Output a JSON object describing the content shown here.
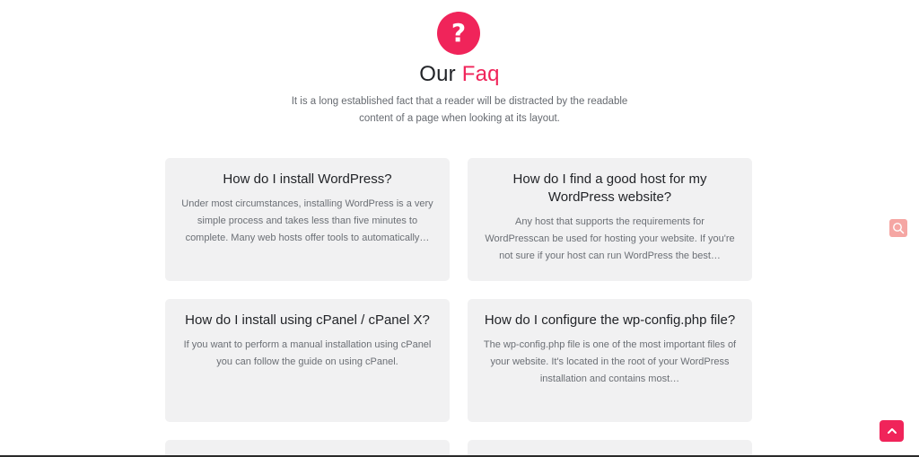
{
  "header": {
    "icon_glyph": "?",
    "title_main": "Our",
    "title_accent": "Faq",
    "description": "It is a long established fact that a reader will be distracted by the readable content of a page when looking at its layout."
  },
  "faqs": [
    {
      "question": "How do I install WordPress?",
      "answer": "Under most circumstances, installing WordPress is a very simple process and takes less than five minutes to complete. Many web hosts offer tools to automatically…"
    },
    {
      "question": "How do I find a good host for my WordPress website?",
      "answer": "Any host that supports the requirements for WordPresscan be used for hosting your website. If you're not sure if your host can run WordPress the best…"
    },
    {
      "question": "How do I install using cPanel / cPanel X?",
      "answer": "If you want to perform a manual installation using cPanel you can follow the guide on using cPanel."
    },
    {
      "question": "How do I configure the wp-config.php file?",
      "answer": "The wp-config.php file is one of the most important files of your website. It's located in the root of your WordPress installation and contains most…"
    }
  ],
  "controls": {
    "search_icon": "search-icon",
    "back_to_top_icon": "chevron-up-icon"
  },
  "colors": {
    "accent": "#f0245a",
    "card_bg": "#f1f1f2",
    "search_bg": "#f5a6a3"
  }
}
